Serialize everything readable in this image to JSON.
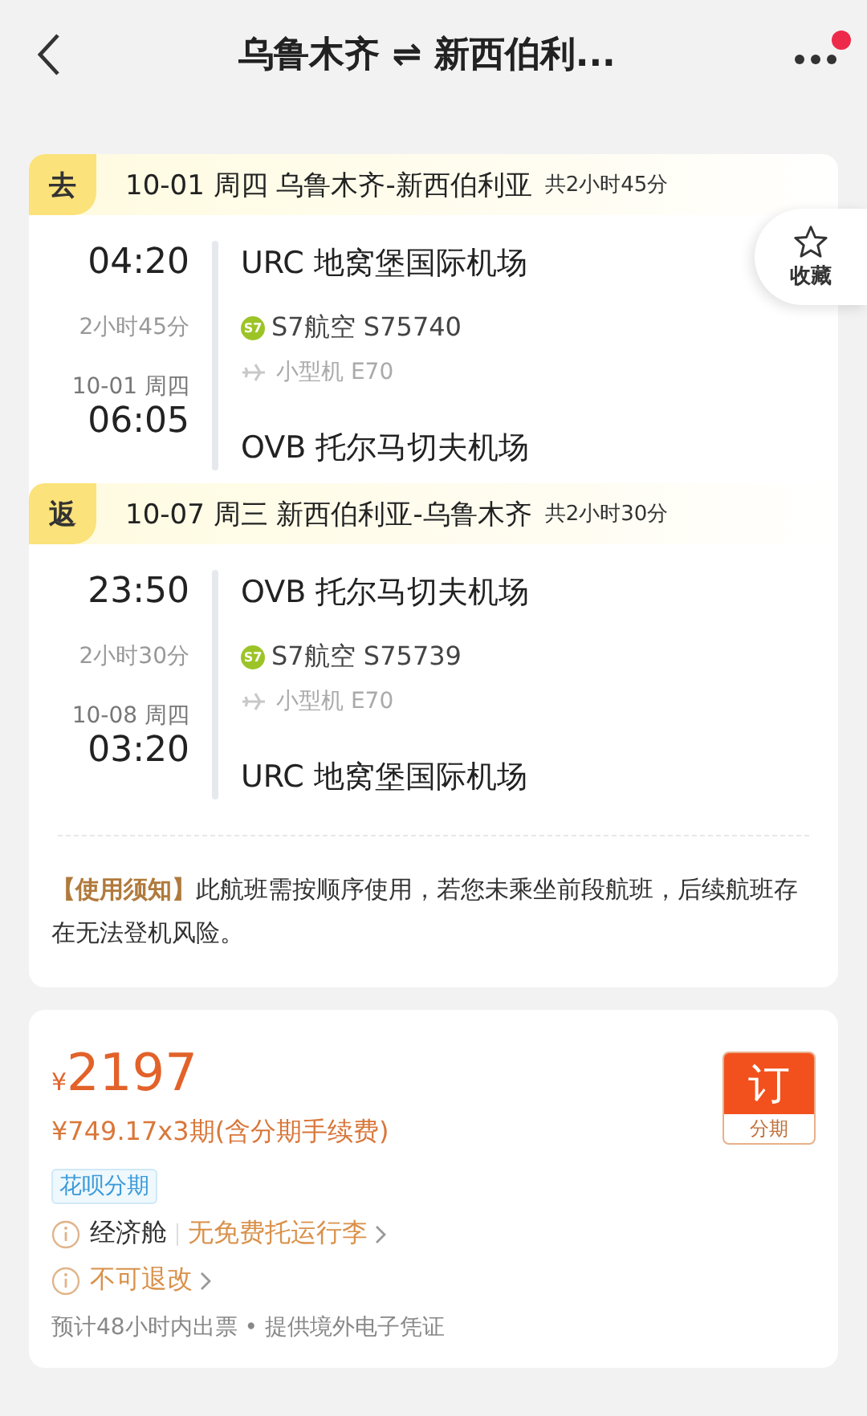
{
  "header": {
    "title": "乌鲁木齐 ⇌ 新西伯利...",
    "has_notification": true
  },
  "favorite": {
    "label": "收藏",
    "selected": false
  },
  "legs": [
    {
      "tag": "去",
      "heading": "10-01 周四 乌鲁木齐-新西伯利亚",
      "total": "共2小时45分",
      "depart_time": "04:20",
      "depart_airport": "URC 地窝堡国际机场",
      "duration": "2小时45分",
      "airline_logo": "S7",
      "airline": "S7航空 S75740",
      "aircraft": "小型机 E70",
      "arrive_date": "10-01 周四",
      "arrive_time": "06:05",
      "arrive_airport": "OVB 托尔马切夫机场"
    },
    {
      "tag": "返",
      "heading": "10-07 周三 新西伯利亚-乌鲁木齐",
      "total": "共2小时30分",
      "depart_time": "23:50",
      "depart_airport": "OVB 托尔马切夫机场",
      "duration": "2小时30分",
      "airline_logo": "S7",
      "airline": "S7航空 S75739",
      "aircraft": "小型机 E70",
      "arrive_date": "10-08 周四",
      "arrive_time": "03:20",
      "arrive_airport": "URC 地窝堡国际机场"
    }
  ],
  "notice": "**【使用须知】**此航班需按顺序使用，若您未乘坐前段航班，后续航班存在无法登机风险。",
  "price": {
    "currency": "¥",
    "amount": "2197",
    "installment": "¥749.17x3期(含分期手续费)",
    "tag": "花呗分期",
    "book_button": {
      "label": "订",
      "sub": "分期"
    },
    "info_rows": [
      {
        "items": [
          {
            "text": "经济舱",
            "link": false
          },
          {
            "text": "无免费托运行李",
            "link": true
          }
        ]
      },
      {
        "items": [
          {
            "text": "不可退改",
            "link": true
          }
        ]
      }
    ],
    "footer": "预计48小时内出票 • 提供境外电子凭证"
  }
}
